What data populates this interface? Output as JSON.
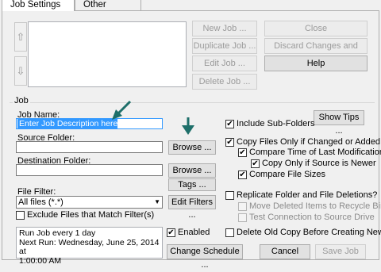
{
  "tabs": {
    "job_settings": "Job Settings",
    "other_settings": "Other Settings"
  },
  "list_buttons": {
    "new_job": "New Job ...",
    "duplicate_job": "Duplicate Job ...",
    "edit_job": "Edit Job ...",
    "delete_job": "Delete Job ...",
    "close": "Close",
    "discard_close": "Discard Changes and Close",
    "help": "Help"
  },
  "arrows": {
    "up": "⇧",
    "down": "⇩"
  },
  "job": {
    "group_label": "Job",
    "name_label": "Job Name:",
    "name_value": "Enter Job Description here",
    "source_label": "Source Folder:",
    "source_value": "",
    "browse1": "Browse ...",
    "dest_label": "Destination Folder:",
    "dest_value": "",
    "browse2": "Browse ...",
    "tags": "Tags ...",
    "filter_label": "File Filter:",
    "filter_value": "All files (*.*)",
    "edit_filters": "Edit Filters ...",
    "exclude_label": "Exclude Files that Match Filter(s)",
    "status_lines": [
      "Run Job every 1 day",
      "Next Run: Wednesday, June 25, 2014 at",
      "1:00:00 AM"
    ],
    "enabled_label": "Enabled",
    "change_schedule": "Change Schedule ...",
    "show_tips": "Show Tips ...",
    "include_subfolders": "Include Sub-Folders",
    "copy_changed": "Copy Files Only if Changed or Added",
    "compare_time": "Compare Time of Last Modification",
    "copy_newer": "Copy Only if Source is Newer",
    "compare_size": "Compare File Sizes",
    "replicate": "Replicate Folder and File Deletions?",
    "move_recycle": "Move Deleted Items to Recycle Bin",
    "test_connection": "Test Connection to Source Drive",
    "delete_old": "Delete Old Copy Before Creating New",
    "cancel": "Cancel",
    "save_job": "Save Job",
    "check": "✔"
  },
  "colors": {
    "pointer": "#1e6f6a",
    "selection": "#3399ff"
  }
}
